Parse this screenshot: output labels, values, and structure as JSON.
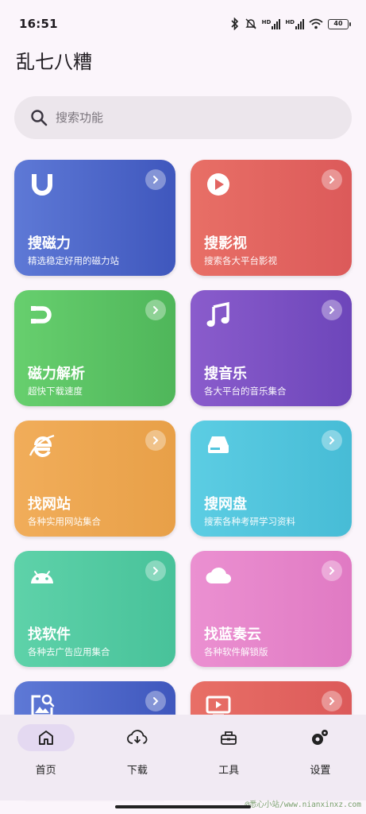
{
  "status": {
    "time": "16:51",
    "network1": "HD",
    "network2": "HD",
    "battery": "40"
  },
  "app": {
    "title": "乱七八糟"
  },
  "search": {
    "placeholder": "搜索功能"
  },
  "cards": [
    {
      "title": "搜磁力",
      "subtitle": "精选稳定好用的磁力站",
      "icon": "magnet-u-icon",
      "color": "#4f68cc"
    },
    {
      "title": "搜影视",
      "subtitle": "搜索各大平台影视",
      "icon": "play-circle-icon",
      "color": "#e26562"
    },
    {
      "title": "磁力解析",
      "subtitle": "超快下载速度",
      "icon": "magnet-icon",
      "color": "#5cc264"
    },
    {
      "title": "搜音乐",
      "subtitle": "各大平台的音乐集合",
      "icon": "music-note-icon",
      "color": "#7c51c4"
    },
    {
      "title": "找网站",
      "subtitle": "各种实用网站集合",
      "icon": "browser-e-icon",
      "color": "#eda651"
    },
    {
      "title": "搜网盘",
      "subtitle": "搜索各种考研学习资料",
      "icon": "drive-icon",
      "color": "#52c5dd"
    },
    {
      "title": "找软件",
      "subtitle": "各种去广告应用集合",
      "icon": "android-icon",
      "color": "#53caa2"
    },
    {
      "title": "找蓝奏云",
      "subtitle": "各种软件解锁版",
      "icon": "cloud-icon",
      "color": "#e585ca"
    },
    {
      "title": "",
      "subtitle": "",
      "icon": "image-search-icon",
      "color": "#4f68cc"
    },
    {
      "title": "",
      "subtitle": "",
      "icon": "tv-play-icon",
      "color": "#e26562"
    }
  ],
  "nav": [
    {
      "label": "首页",
      "icon": "home-icon",
      "active": true
    },
    {
      "label": "下载",
      "icon": "cloud-download-icon",
      "active": false
    },
    {
      "label": "工具",
      "icon": "toolbox-icon",
      "active": false
    },
    {
      "label": "设置",
      "icon": "gears-icon",
      "active": false
    }
  ],
  "watermark": "@悉心小站/www.nianxinxz.com"
}
